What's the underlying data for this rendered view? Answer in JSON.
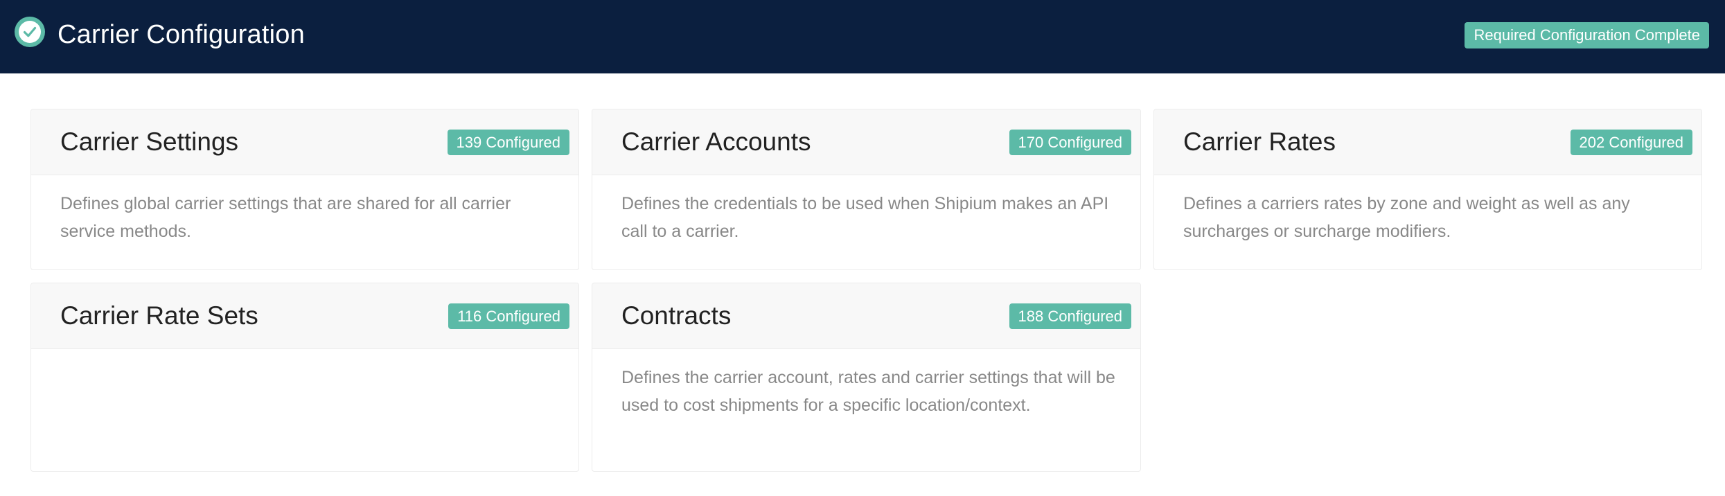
{
  "header": {
    "logo_icon": "check-circle-icon",
    "title": "Carrier Configuration",
    "status_badge": "Required Configuration Complete",
    "colors": {
      "background": "#0b1f3f",
      "accent": "#5cbaa7"
    }
  },
  "cards": [
    {
      "title": "Carrier Settings",
      "badge": "139 Configured",
      "description": "Defines global carrier settings that are shared for all carrier service methods."
    },
    {
      "title": "Carrier Accounts",
      "badge": "170 Configured",
      "description": "Defines the credentials to be used when Shipium makes an API call to a carrier."
    },
    {
      "title": "Carrier Rates",
      "badge": "202 Configured",
      "description": "Defines a carriers rates by zone and weight as well as any surcharges or surcharge modifiers."
    },
    {
      "title": "Carrier Rate Sets",
      "badge": "116 Configured",
      "description": ""
    },
    {
      "title": "Contracts",
      "badge": "188 Configured",
      "description": "Defines the carrier account, rates and carrier settings that will be used to cost shipments for a specific location/context."
    }
  ]
}
